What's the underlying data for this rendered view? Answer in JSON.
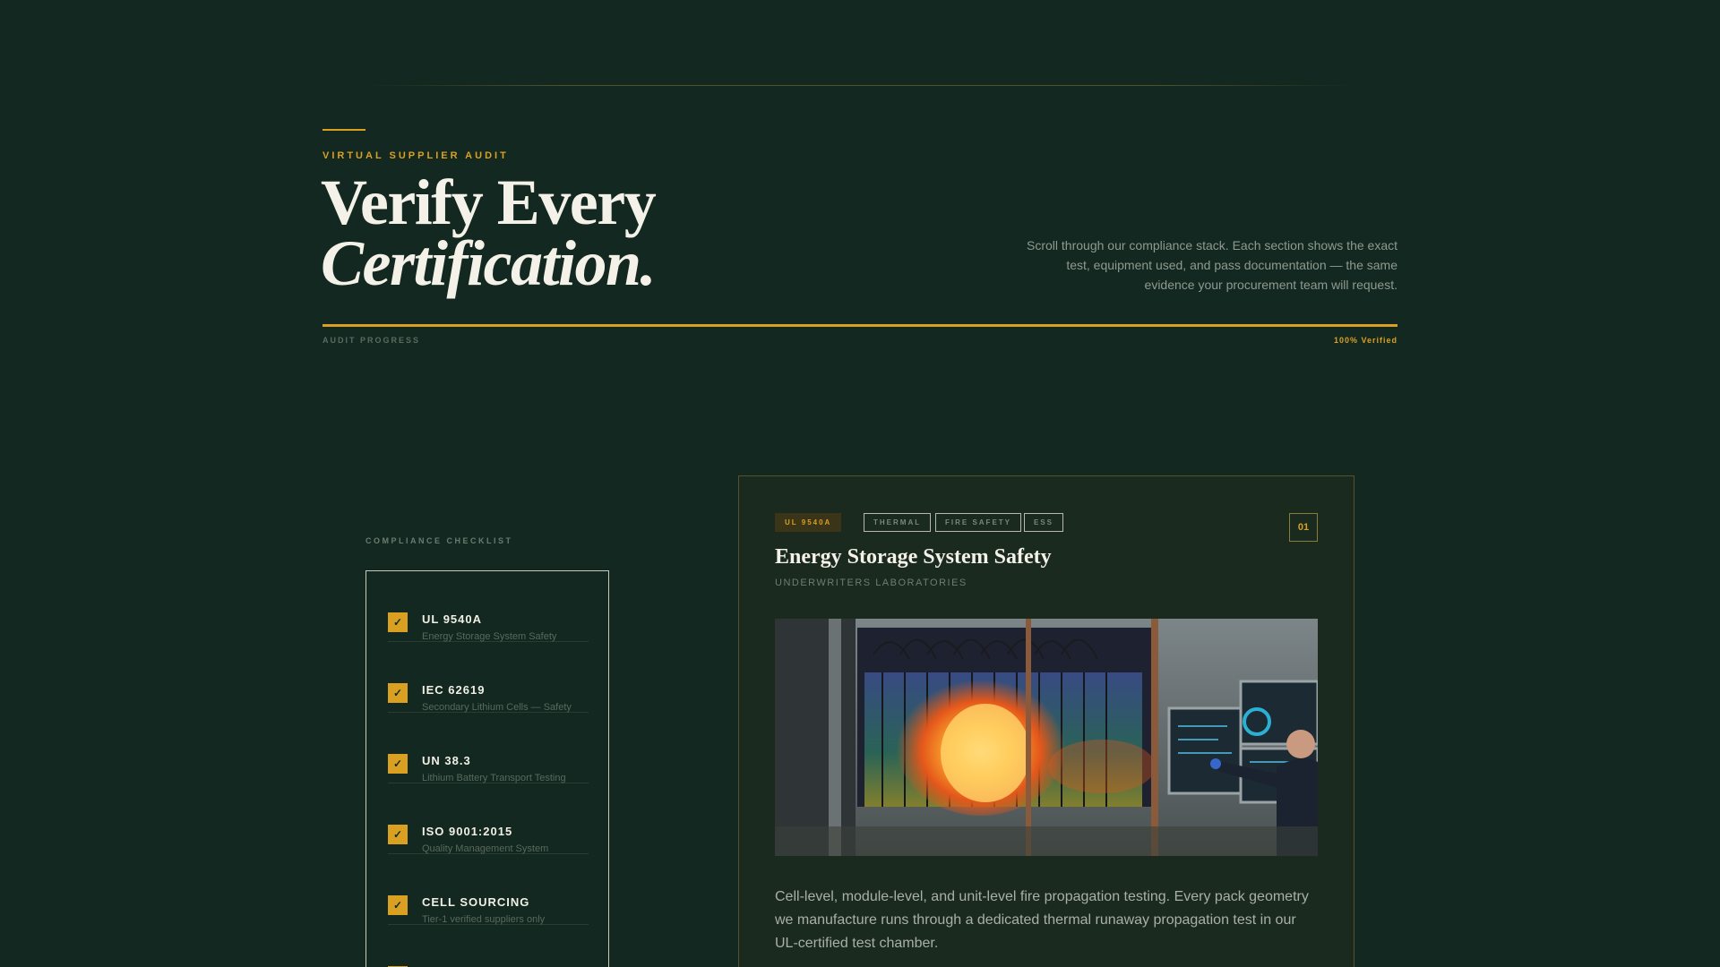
{
  "header": {
    "eyebrow": "VIRTUAL SUPPLIER AUDIT",
    "title_line1": "Verify Every",
    "title_line2": "Certification.",
    "description": "Scroll through our compliance stack. Each section shows the exact test, equipment used, and pass documentation — the same evidence your procurement team will request."
  },
  "progress": {
    "label": "AUDIT PROGRESS",
    "value_text": "100% Verified",
    "value": 1.0
  },
  "checklist": {
    "label": "COMPLIANCE CHECKLIST",
    "items": [
      {
        "title": "UL 9540A",
        "subtitle": "Energy Storage System Safety",
        "checked": true
      },
      {
        "title": "IEC 62619",
        "subtitle": "Secondary Lithium Cells — Safety",
        "checked": true
      },
      {
        "title": "UN 38.3",
        "subtitle": "Lithium Battery Transport Testing",
        "checked": true
      },
      {
        "title": "ISO 9001:2015",
        "subtitle": "Quality Management System",
        "checked": true
      },
      {
        "title": "CELL SOURCING",
        "subtitle": "Tier-1 verified suppliers only",
        "checked": true
      }
    ]
  },
  "card": {
    "tags": [
      "UL 9540A",
      "THERMAL",
      "FIRE SAFETY",
      "ESS"
    ],
    "number": "01",
    "title": "Energy Storage System Safety",
    "subtitle": "UNDERWRITERS LABORATORIES",
    "image_alt": "battery rack thermal runaway fire test in lab",
    "description": "Cell-level, module-level, and unit-level fire propagation testing. Every pack geometry we manufacture runs through a dedicated thermal runaway propagation test in our UL-certified test chamber."
  },
  "colors": {
    "background": "#132820",
    "accent": "#d9a021"
  }
}
